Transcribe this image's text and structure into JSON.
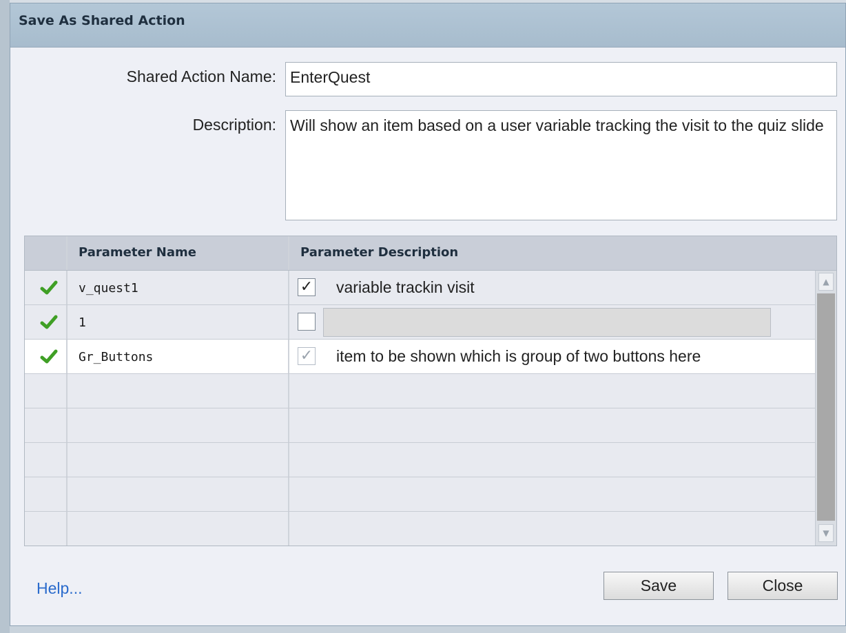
{
  "dialog": {
    "title": "Save As Shared Action",
    "name_label": "Shared Action Name:",
    "name_value": "EnterQuest",
    "description_label": "Description:",
    "description_value": "Will show an item based on a user variable tracking the visit to the quiz slide"
  },
  "grid": {
    "headers": [
      "Parameter Name",
      "Parameter Description"
    ],
    "rows": [
      {
        "name": "v_quest1",
        "checked": true,
        "description": "variable trackin visit"
      },
      {
        "name": "1",
        "checked": false,
        "description": ""
      },
      {
        "name": "Gr_Buttons",
        "checked": true,
        "description": "item to be shown which is group of two buttons here"
      }
    ]
  },
  "footer": {
    "help_label": "Help...",
    "save_label": "Save",
    "close_label": "Close"
  },
  "icons": {
    "row_status": "green-check-icon",
    "scroll_up": "scroll-up-arrow-icon",
    "scroll_down": "scroll-down-arrow-icon"
  },
  "colors": {
    "titlebar": "#b3c7d7",
    "check_green": "#4caf2a",
    "link": "#2a6bcc"
  }
}
